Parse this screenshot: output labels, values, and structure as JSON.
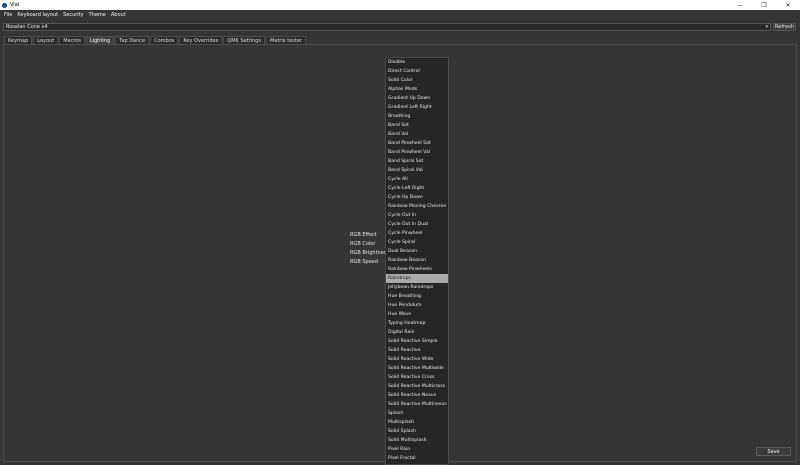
{
  "window": {
    "title": "Vial",
    "minimize_glyph": "—",
    "maximize_glyph": "❐",
    "close_glyph": "✕"
  },
  "menu": [
    "File",
    "Keyboard layout",
    "Security",
    "Theme",
    "About"
  ],
  "keyboard_selector": {
    "value": "Rosalan Cone v4",
    "arrow": "▾"
  },
  "refresh_label": "Refresh",
  "tabs": [
    "Keymap",
    "Layout",
    "Macros",
    "Lighting",
    "Tap Dance",
    "Combos",
    "Key Overrides",
    "QMK Settings",
    "Matrix tester"
  ],
  "active_tab": "Lighting",
  "rgb_labels": [
    "RGB Effect",
    "RGB Color",
    "RGB Brightness",
    "RGB Speed"
  ],
  "effects": [
    "Disable",
    "Direct Control",
    "Solid Color",
    "Alphas Mods",
    "Gradient Up Down",
    "Gradient Left Right",
    "Breathing",
    "Band Sat",
    "Band Val",
    "Band Pinwheel Sat",
    "Band Pinwheel Val",
    "Band Spiral Sat",
    "Band Spiral Val",
    "Cycle All",
    "Cycle Left Right",
    "Cycle Up Down",
    "Rainbow Moving Chevron",
    "Cycle Out In",
    "Cycle Out In Dual",
    "Cycle Pinwheel",
    "Cycle Spiral",
    "Dual Beacon",
    "Rainbow Beacon",
    "Rainbow Pinwheels",
    "Raindrops",
    "Jellybean Raindrops",
    "Hue Breathing",
    "Hue Pendulum",
    "Hue Wave",
    "Typing Heatmap",
    "Digital Rain",
    "Solid Reactive Simple",
    "Solid Reactive",
    "Solid Reactive Wide",
    "Solid Reactive Multiwide",
    "Solid Reactive Cross",
    "Solid Reactive Multicross",
    "Solid Reactive Nexus",
    "Solid Reactive Multinexus",
    "Splash",
    "Multisplash",
    "Solid Splash",
    "Solid Multisplash",
    "Pixel Rain",
    "Pixel Fractal"
  ],
  "selected_effect": "Raindrops",
  "save_label": "Save",
  "colors": {
    "background": "#353535",
    "titlebar": "#ffffff",
    "list_background": "#262626",
    "selection": "#a9a9a9"
  }
}
